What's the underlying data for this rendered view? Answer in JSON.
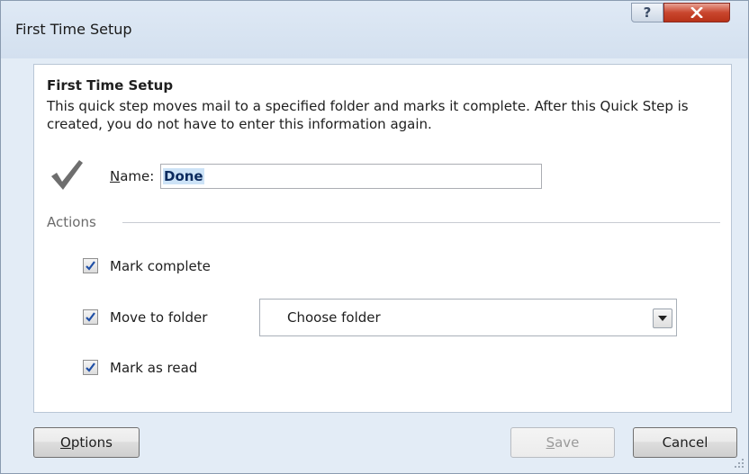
{
  "window": {
    "title": "First Time Setup",
    "help_label": "?",
    "close_label": "X"
  },
  "panel": {
    "heading": "First Time Setup",
    "description": "This quick step moves mail to a specified folder and marks it complete. After this Quick Step is created, you do not have to enter this information again.",
    "name_label_accel": "N",
    "name_label_rest": "ame:",
    "name_value": "Done"
  },
  "actions": {
    "section_label": "Actions",
    "items": [
      {
        "label": "Mark complete",
        "checked": true
      },
      {
        "label": "Move to folder",
        "checked": true
      },
      {
        "label": "Mark as read",
        "checked": true
      }
    ],
    "folder_select": {
      "value": "Choose folder"
    }
  },
  "footer": {
    "options_accel": "O",
    "options_rest": "ptions",
    "save_accel": "S",
    "save_rest": "ave",
    "save_enabled": false,
    "cancel_label": "Cancel"
  },
  "colors": {
    "accent": "#0b2a5e",
    "checkmark": "#6e6e6e",
    "close_button": "#c9462e"
  },
  "icons": [
    "help-icon",
    "close-icon",
    "checkmark-icon",
    "checkbox-check-icon",
    "dropdown-arrow-icon",
    "resize-grip-icon"
  ]
}
